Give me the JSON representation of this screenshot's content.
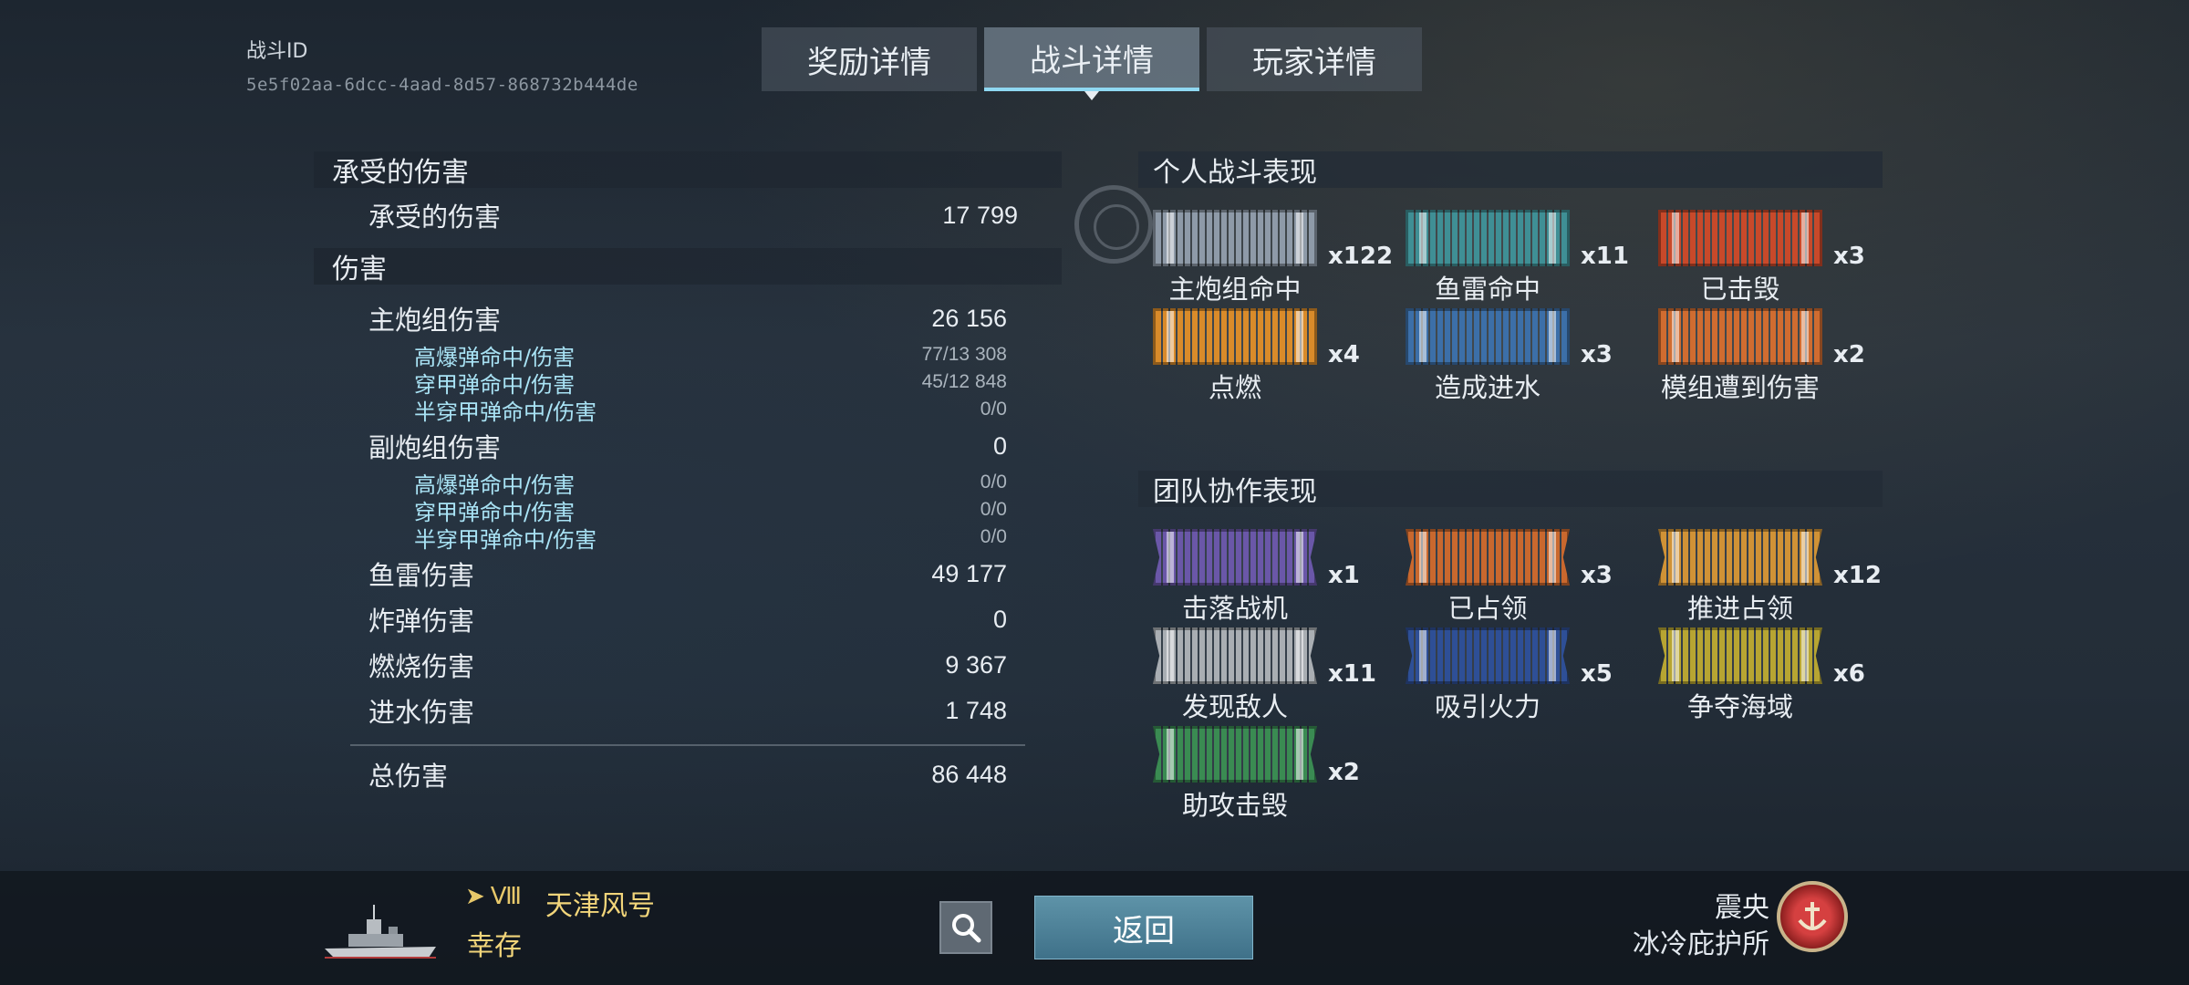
{
  "battle": {
    "id_label": "战斗ID",
    "id_value": "5e5f02aa-6dcc-4aad-8d57-868732b444de"
  },
  "tabs": [
    {
      "label": "奖励详情",
      "active": false
    },
    {
      "label": "战斗详情",
      "active": true
    },
    {
      "label": "玩家详情",
      "active": false
    }
  ],
  "damage_taken": {
    "header": "承受的伤害",
    "label": "承受的伤害",
    "value": "17 799"
  },
  "damage": {
    "header": "伤害",
    "main_battery": {
      "label": "主炮组伤害",
      "value": "26 156",
      "rows": [
        {
          "label": "高爆弹命中/伤害",
          "value": "77/13 308"
        },
        {
          "label": "穿甲弹命中/伤害",
          "value": "45/12 848"
        },
        {
          "label": "半穿甲弹命中/伤害",
          "value": "0/0"
        }
      ]
    },
    "secondary": {
      "label": "副炮组伤害",
      "value": "0",
      "rows": [
        {
          "label": "高爆弹命中/伤害",
          "value": "0/0"
        },
        {
          "label": "穿甲弹命中/伤害",
          "value": "0/0"
        },
        {
          "label": "半穿甲弹命中/伤害",
          "value": "0/0"
        }
      ]
    },
    "torpedo": {
      "label": "鱼雷伤害",
      "value": "49 177"
    },
    "bomb": {
      "label": "炸弹伤害",
      "value": "0"
    },
    "fire": {
      "label": "燃烧伤害",
      "value": "9 367"
    },
    "flood": {
      "label": "进水伤害",
      "value": "1 748"
    },
    "total": {
      "label": "总伤害",
      "value": "86 448"
    }
  },
  "personal": {
    "header": "个人战斗表现",
    "medals": [
      {
        "label": "主炮组命中",
        "count": "x122",
        "color": "#8e9aa8",
        "icon": "shell-icon"
      },
      {
        "label": "鱼雷命中",
        "count": "x11",
        "color": "#3f8f95",
        "icon": "torpedo-icon"
      },
      {
        "label": "已击毁",
        "count": "x3",
        "color": "#c8492a",
        "icon": "sinking-ship-icon"
      },
      {
        "label": "点燃",
        "count": "x4",
        "color": "#d98b2a",
        "icon": "fire-icon"
      },
      {
        "label": "造成进水",
        "count": "x3",
        "color": "#3c6fa8",
        "icon": "flooding-icon"
      },
      {
        "label": "模组遭到伤害",
        "count": "x2",
        "color": "#d06c30",
        "icon": "module-damage-icon"
      }
    ]
  },
  "team": {
    "header": "团队协作表现",
    "medals": [
      {
        "label": "击落战机",
        "count": "x1",
        "color": "#6a57a8",
        "icon": "crosshair-icon"
      },
      {
        "label": "已占领",
        "count": "x3",
        "color": "#c9682e",
        "icon": "flag-icon"
      },
      {
        "label": "推进占领",
        "count": "x12",
        "color": "#d09236",
        "icon": "capture-icon"
      },
      {
        "label": "发现敌人",
        "count": "x11",
        "color": "#a9aeb3",
        "icon": "radar-icon"
      },
      {
        "label": "吸引火力",
        "count": "x5",
        "color": "#2e4f96",
        "icon": "tank-ship-icon"
      },
      {
        "label": "争夺海域",
        "count": "x6",
        "color": "#b7a532",
        "icon": "contest-icon"
      },
      {
        "label": "助攻击毁",
        "count": "x2",
        "color": "#3a8b52",
        "icon": "assist-icon"
      }
    ]
  },
  "footer": {
    "tier": "Ⅷ",
    "ship_name": "天津风号",
    "status": "幸存",
    "back_label": "返回",
    "player_name": "震央",
    "clan_name": "冰冷庇护所"
  }
}
